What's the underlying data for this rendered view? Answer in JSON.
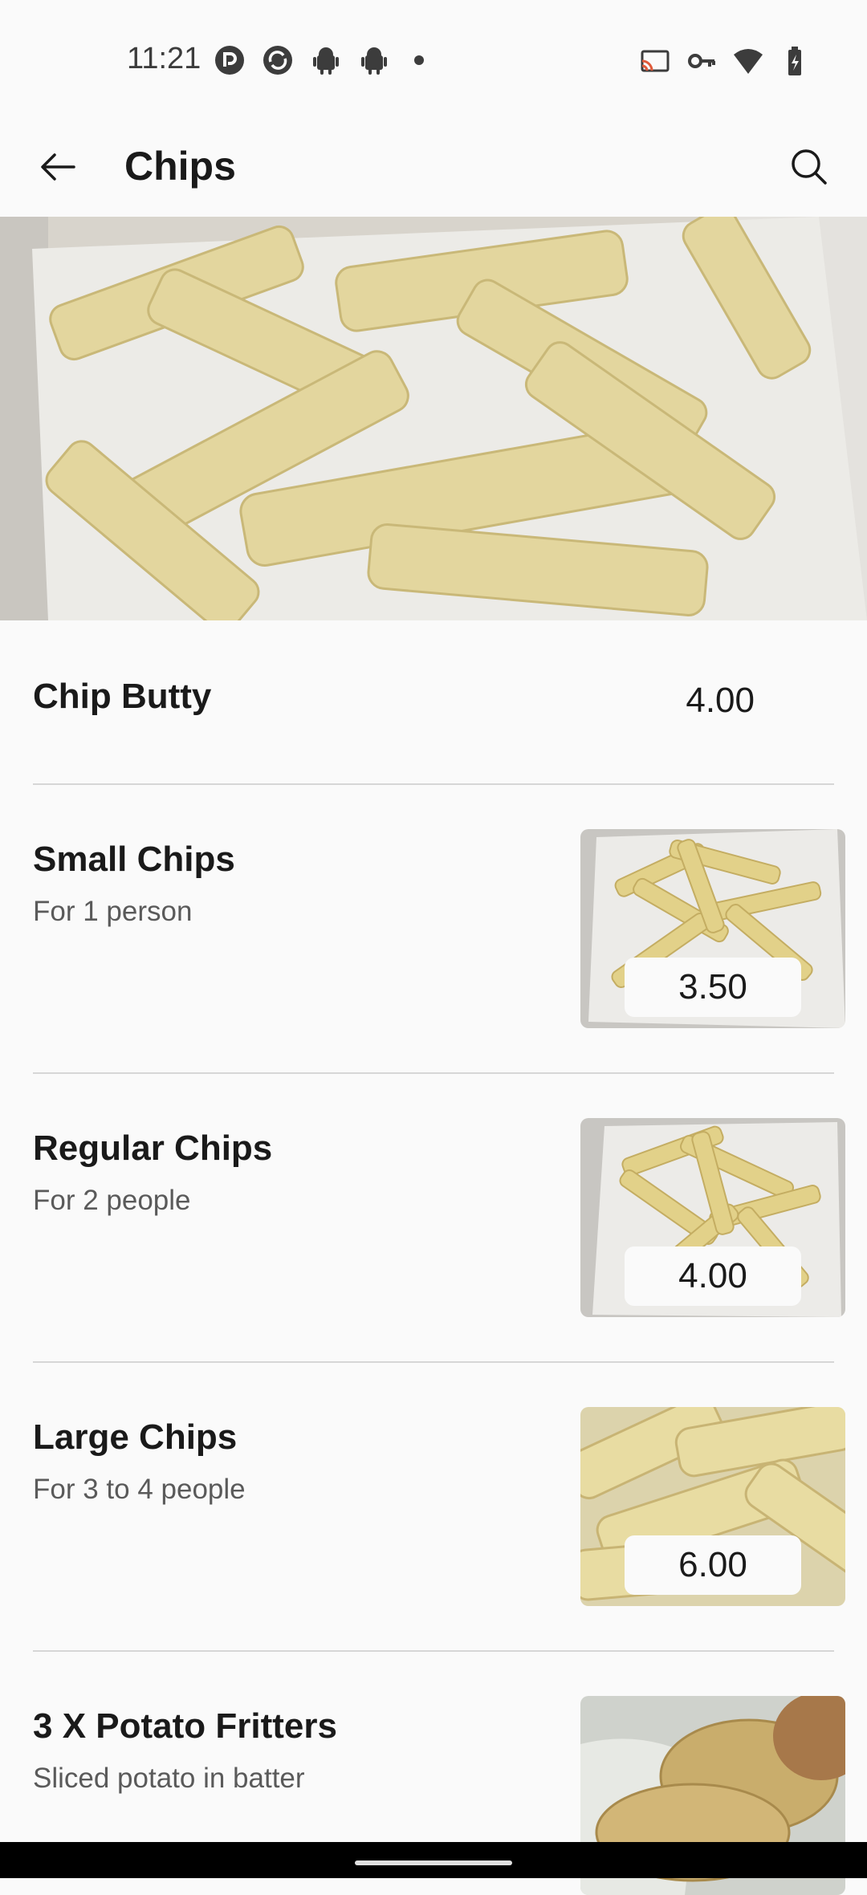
{
  "status_bar": {
    "time": "11:21"
  },
  "app_bar": {
    "title": "Chips"
  },
  "items": [
    {
      "name": "Chip Butty",
      "price": "4.00"
    },
    {
      "name": "Small Chips",
      "description": "For 1 person",
      "price": "3.50"
    },
    {
      "name": "Regular Chips",
      "description": "For 2 people",
      "price": "4.00"
    },
    {
      "name": "Large Chips",
      "description": "For 3 to 4 people",
      "price": "6.00"
    },
    {
      "name": "3 X Potato Fritters",
      "description": "Sliced potato in batter",
      "price": ""
    }
  ],
  "colors": {
    "background": "#fafafa",
    "divider": "#d6d6d6",
    "text_primary": "#1a1a1a",
    "text_secondary": "#5a5a5a"
  }
}
